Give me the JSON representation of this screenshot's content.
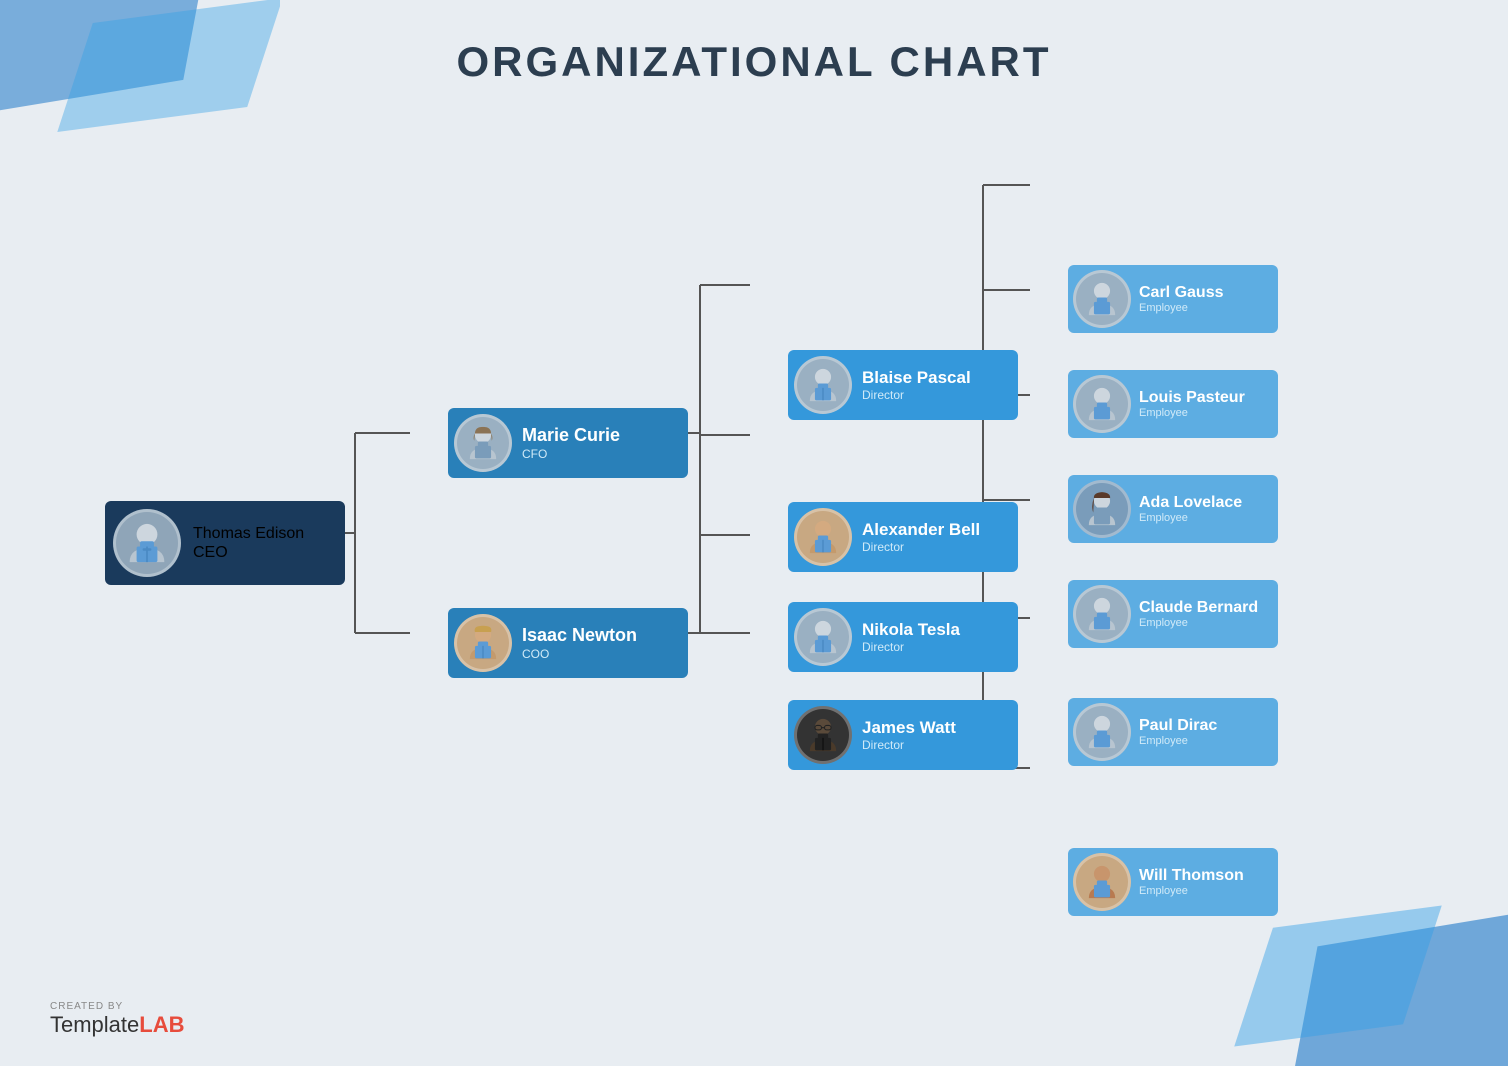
{
  "title": "ORGANIZATIONAL CHART",
  "ceo": {
    "name": "Thomas Edison",
    "role": "CEO"
  },
  "mid_level": [
    {
      "name": "Marie Curie",
      "role": "CFO"
    },
    {
      "name": "Isaac Newton",
      "role": "COO"
    }
  ],
  "directors": [
    {
      "name": "Blaise Pascal",
      "role": "Director"
    },
    {
      "name": "Alexander Bell",
      "role": "Director"
    },
    {
      "name": "Nikola Tesla",
      "role": "Director"
    },
    {
      "name": "James Watt",
      "role": "Director"
    }
  ],
  "employees": [
    {
      "name": "Carl Gauss",
      "role": "Employee"
    },
    {
      "name": "Louis Pasteur",
      "role": "Employee"
    },
    {
      "name": "Ada Lovelace",
      "role": "Employee"
    },
    {
      "name": "Claude Bernard",
      "role": "Employee"
    },
    {
      "name": "Paul Dirac",
      "role": "Employee"
    },
    {
      "name": "Will Thomson",
      "role": "Employee"
    }
  ],
  "watermark": {
    "created_by": "CREATED BY",
    "brand_regular": "Template",
    "brand_bold": "LAB"
  },
  "colors": {
    "ceo_bg": "#1a3a5c",
    "mid_bg": "#2980b9",
    "dir_bg": "#3498db",
    "emp_bg": "#5dade2",
    "connector": "#555555",
    "background": "#e8edf2",
    "title": "#2c3e50"
  }
}
